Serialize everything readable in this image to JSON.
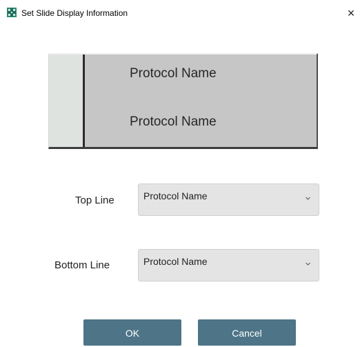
{
  "window": {
    "title": "Set Slide Display Information",
    "close_glyph": "×",
    "app_icon": "slide-app-icon"
  },
  "preview": {
    "top_line": "Protocol Name",
    "bottom_line": "Protocol Name"
  },
  "form": {
    "top_line_label": "Top Line",
    "top_line_value": "Protocol Name",
    "bottom_line_label": "Bottom Line",
    "bottom_line_value": "Protocol Name"
  },
  "buttons": {
    "ok": "OK",
    "cancel": "Cancel"
  },
  "colors": {
    "button_bg": "#4d7487",
    "preview_bg": "#c6c6c6",
    "preview_strip": "#dfe3df",
    "combo_bg": "#e4e4e4",
    "app_icon_accent": "#2e8a76"
  }
}
